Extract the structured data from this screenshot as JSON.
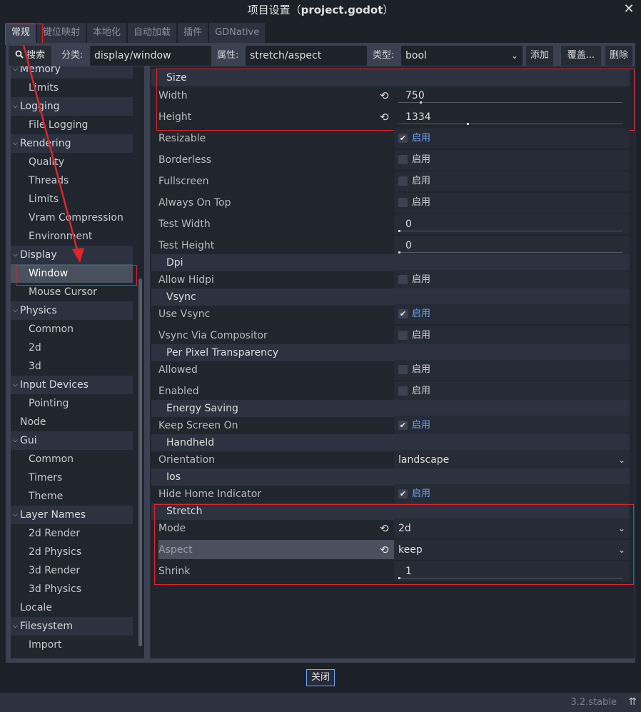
{
  "window": {
    "title_prefix": "项目设置（",
    "title_project": "project.godot",
    "title_suffix": "）",
    "close_glyph": "✕"
  },
  "tabs": [
    "常规",
    "键位映射",
    "本地化",
    "自动加载",
    "插件",
    "GDNative"
  ],
  "toolbar": {
    "search_label": "搜索",
    "category_label": "分类:",
    "category_value": "display/window",
    "property_label": "属性:",
    "property_value": "stretch/aspect",
    "type_label": "类型:",
    "type_value": "bool",
    "add_label": "添加",
    "override_label": "覆盖...",
    "delete_label": "删除"
  },
  "sidebar": {
    "items": [
      {
        "label": "Memory",
        "kind": "cat"
      },
      {
        "label": "Limits",
        "kind": "leaf"
      },
      {
        "label": "Logging",
        "kind": "cat"
      },
      {
        "label": "File Logging",
        "kind": "leaf"
      },
      {
        "label": "Rendering",
        "kind": "cat"
      },
      {
        "label": "Quality",
        "kind": "leaf"
      },
      {
        "label": "Threads",
        "kind": "leaf"
      },
      {
        "label": "Limits",
        "kind": "leaf"
      },
      {
        "label": "Vram Compression",
        "kind": "leaf"
      },
      {
        "label": "Environment",
        "kind": "leaf"
      },
      {
        "label": "Display",
        "kind": "cat"
      },
      {
        "label": "Window",
        "kind": "selected"
      },
      {
        "label": "Mouse Cursor",
        "kind": "leaf"
      },
      {
        "label": "Physics",
        "kind": "cat"
      },
      {
        "label": "Common",
        "kind": "leaf"
      },
      {
        "label": "2d",
        "kind": "leaf"
      },
      {
        "label": "3d",
        "kind": "leaf"
      },
      {
        "label": "Input Devices",
        "kind": "cat"
      },
      {
        "label": "Pointing",
        "kind": "leaf"
      },
      {
        "label": "Node",
        "kind": "plain"
      },
      {
        "label": "Gui",
        "kind": "cat"
      },
      {
        "label": "Common",
        "kind": "leaf"
      },
      {
        "label": "Timers",
        "kind": "leaf"
      },
      {
        "label": "Theme",
        "kind": "leaf"
      },
      {
        "label": "Layer Names",
        "kind": "cat"
      },
      {
        "label": "2d Render",
        "kind": "leaf"
      },
      {
        "label": "2d Physics",
        "kind": "leaf"
      },
      {
        "label": "3d Render",
        "kind": "leaf"
      },
      {
        "label": "3d Physics",
        "kind": "leaf"
      },
      {
        "label": "Locale",
        "kind": "plain"
      },
      {
        "label": "Filesystem",
        "kind": "cat"
      },
      {
        "label": "Import",
        "kind": "leaf"
      }
    ]
  },
  "enabled_label": "启用",
  "sections": {
    "size": "Size",
    "dpi": "Dpi",
    "vsync": "Vsync",
    "ppt": "Per Pixel Transparency",
    "energy": "Energy Saving",
    "handheld": "Handheld",
    "ios": "Ios",
    "stretch": "Stretch"
  },
  "props": {
    "width": {
      "name": "Width",
      "value": "750"
    },
    "height": {
      "name": "Height",
      "value": "1334"
    },
    "resizable": {
      "name": "Resizable",
      "checked": true
    },
    "borderless": {
      "name": "Borderless",
      "checked": false
    },
    "fullscreen": {
      "name": "Fullscreen",
      "checked": false
    },
    "always_on_top": {
      "name": "Always On Top",
      "checked": false
    },
    "test_width": {
      "name": "Test Width",
      "value": "0"
    },
    "test_height": {
      "name": "Test Height",
      "value": "0"
    },
    "allow_hidpi": {
      "name": "Allow Hidpi",
      "checked": false
    },
    "use_vsync": {
      "name": "Use Vsync",
      "checked": true
    },
    "vsync_compositor": {
      "name": "Vsync Via Compositor",
      "checked": false
    },
    "allowed": {
      "name": "Allowed",
      "checked": false
    },
    "enabled": {
      "name": "Enabled",
      "checked": false
    },
    "keep_screen_on": {
      "name": "Keep Screen On",
      "checked": true
    },
    "orientation": {
      "name": "Orientation",
      "value": "landscape"
    },
    "hide_home": {
      "name": "Hide Home Indicator",
      "checked": true
    },
    "mode": {
      "name": "Mode",
      "value": "2d"
    },
    "aspect": {
      "name": "Aspect",
      "value": "keep"
    },
    "shrink": {
      "name": "Shrink",
      "value": "1"
    }
  },
  "footer": {
    "close_label": "关闭"
  },
  "status": {
    "version": "3.2.stable",
    "icon": "⇈"
  }
}
